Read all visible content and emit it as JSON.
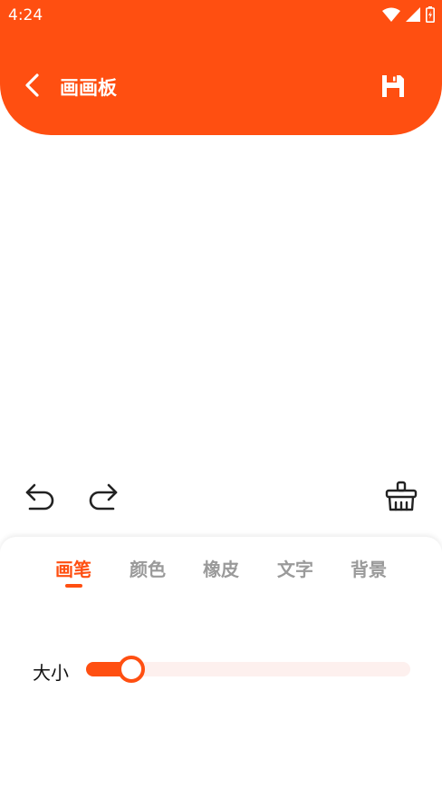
{
  "status_bar": {
    "time": "4:24"
  },
  "header": {
    "title": "画画板"
  },
  "tabs": [
    {
      "label": "画笔",
      "active": true
    },
    {
      "label": "颜色",
      "active": false
    },
    {
      "label": "橡皮",
      "active": false
    },
    {
      "label": "文字",
      "active": false
    },
    {
      "label": "背景",
      "active": false
    }
  ],
  "brush": {
    "size_label": "大小",
    "size_fraction": 0.14
  },
  "colors": {
    "accent": "#ff4f11",
    "inactive_tab": "#9a9a9a",
    "slider_track": "#fdf0ee"
  },
  "icons": {
    "back": "chevron-left-icon",
    "save": "floppy-disk-icon",
    "undo": "undo-icon",
    "redo": "redo-icon",
    "clear": "broom-basket-icon"
  }
}
